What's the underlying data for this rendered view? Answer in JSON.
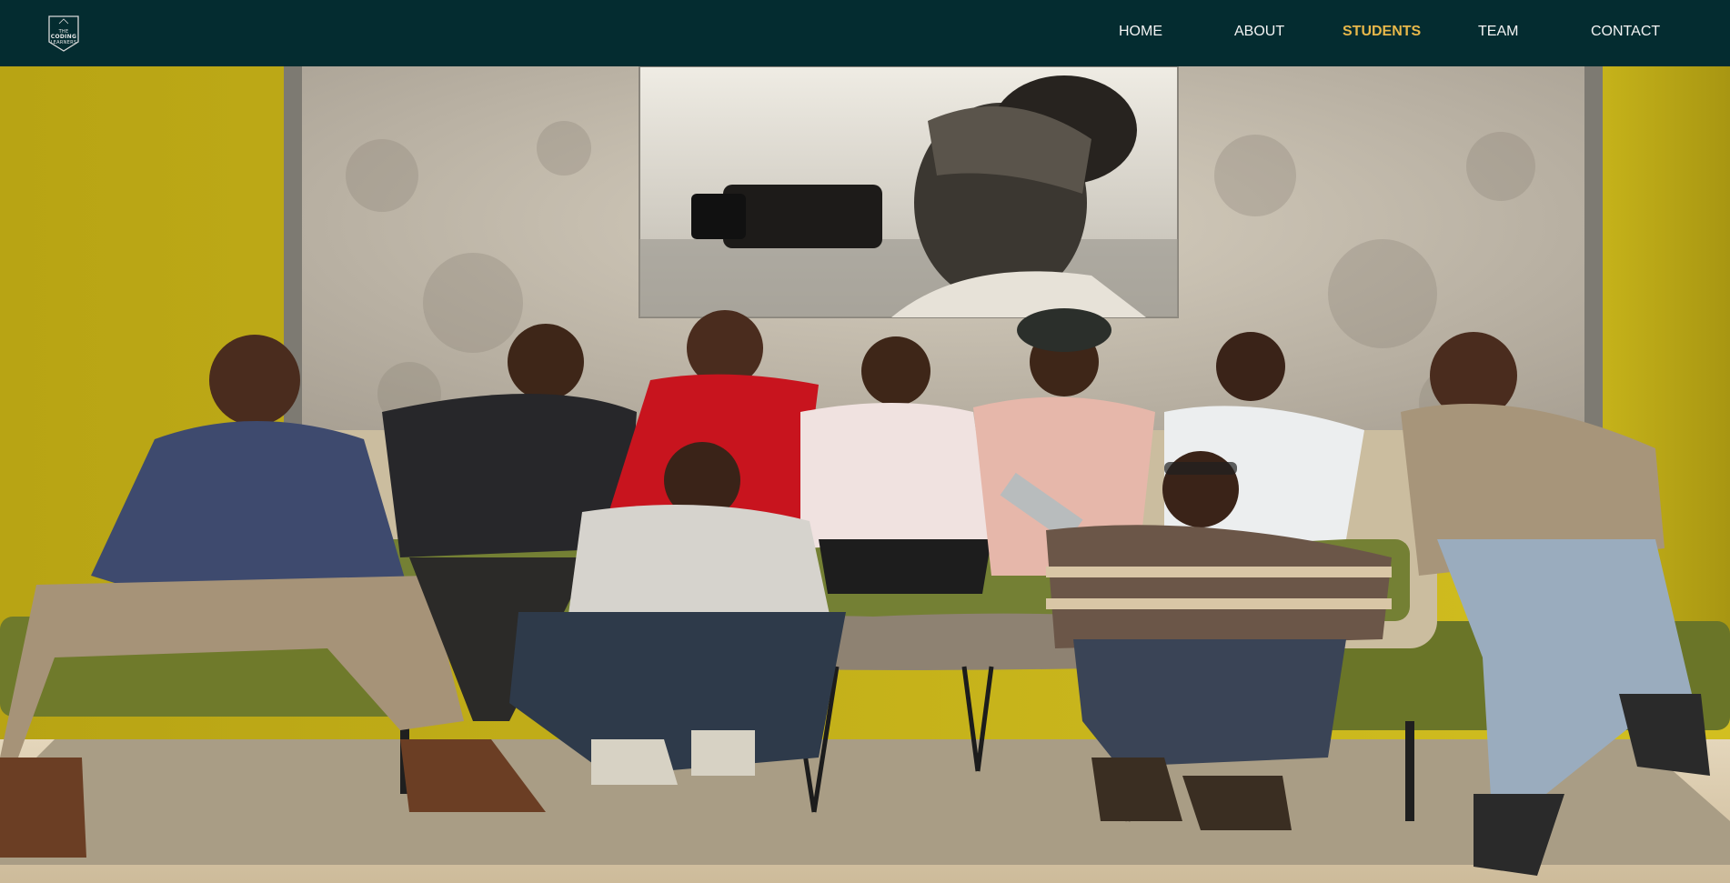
{
  "navbar": {
    "logo": {
      "line1": "THE",
      "line2": "CODING",
      "line3": "LEARNERS",
      "icon": "shield-logo-icon"
    },
    "links": [
      {
        "label": "HOME",
        "active": false
      },
      {
        "label": "ABOUT",
        "active": false
      },
      {
        "label": "STUDENTS",
        "active": true
      },
      {
        "label": "TEAM",
        "active": false
      },
      {
        "label": "CONTACT",
        "active": false
      }
    ]
  },
  "colors": {
    "navbar_bg": "#042c30",
    "active_link": "#e8b84a",
    "link": "#f4f4f4",
    "wall_yellow": "#c8b414",
    "wall_texture": "#cfc7b8"
  },
  "hero": {
    "image": "group-photo-students-on-couch"
  }
}
